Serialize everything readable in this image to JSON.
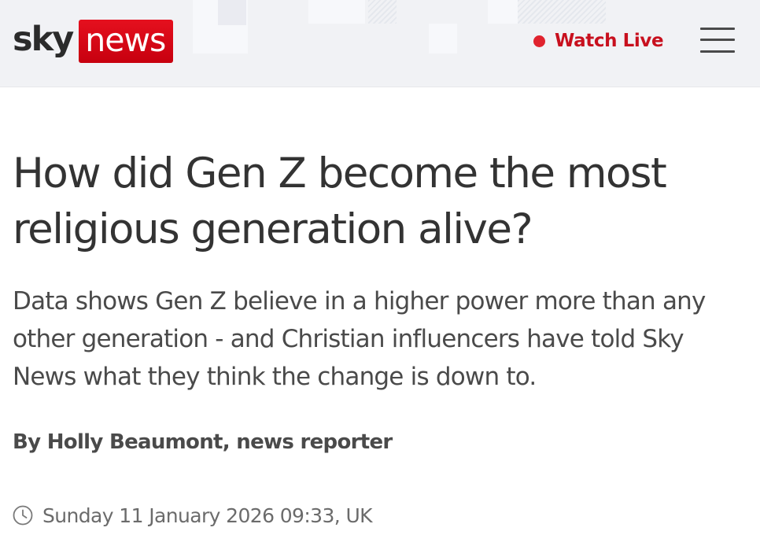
{
  "header": {
    "logo_sky": "sky",
    "logo_news": "news",
    "watch_live_label": "Watch Live",
    "menu_icon": "hamburger-menu-icon",
    "live_dot_color": "#e0232e",
    "brand_red": "#c8101e"
  },
  "article": {
    "headline": "How did Gen Z become the most religious generation alive?",
    "standfirst": "Data shows Gen Z believe in a higher power more than any other generation - and Christian influencers have told Sky News what they think the change is down to.",
    "byline": "By Holly Beaumont, news reporter",
    "timestamp": "Sunday 11 January 2026 09:33, UK",
    "timestamp_icon": "clock-icon"
  }
}
